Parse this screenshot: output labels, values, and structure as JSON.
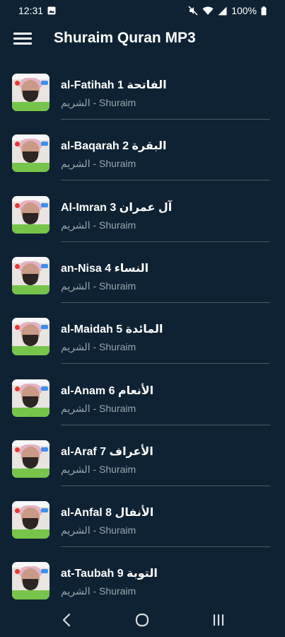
{
  "status_bar": {
    "time": "12:31",
    "battery": "100%"
  },
  "app_bar": {
    "title": "Shuraim Quran MP3"
  },
  "items": [
    {
      "title": "al-Fatihah  الفاتحة 1",
      "subtitle": "الشريم - Shuraim"
    },
    {
      "title": "al-Baqarah البقرة 2",
      "subtitle": "الشريم - Shuraim"
    },
    {
      "title": "Al-Imran  آل عمران 3",
      "subtitle": "الشريم - Shuraim"
    },
    {
      "title": "an-Nisa النساء 4",
      "subtitle": "الشريم - Shuraim"
    },
    {
      "title": "al-Maidah  المائدة 5",
      "subtitle": "الشريم - Shuraim"
    },
    {
      "title": "al-Anam  الأنعام 6",
      "subtitle": "الشريم - Shuraim"
    },
    {
      "title": "al-Araf  الأعراف 7",
      "subtitle": "الشريم - Shuraim"
    },
    {
      "title": "al-Anfal  الأنفال 8",
      "subtitle": "الشريم - Shuraim"
    },
    {
      "title": "at-Taubah التوبة 9",
      "subtitle": "الشريم - Shuraim"
    }
  ],
  "icons": {
    "menu": "menu-icon",
    "back": "back-icon",
    "home": "home-icon",
    "recents": "recents-icon"
  }
}
